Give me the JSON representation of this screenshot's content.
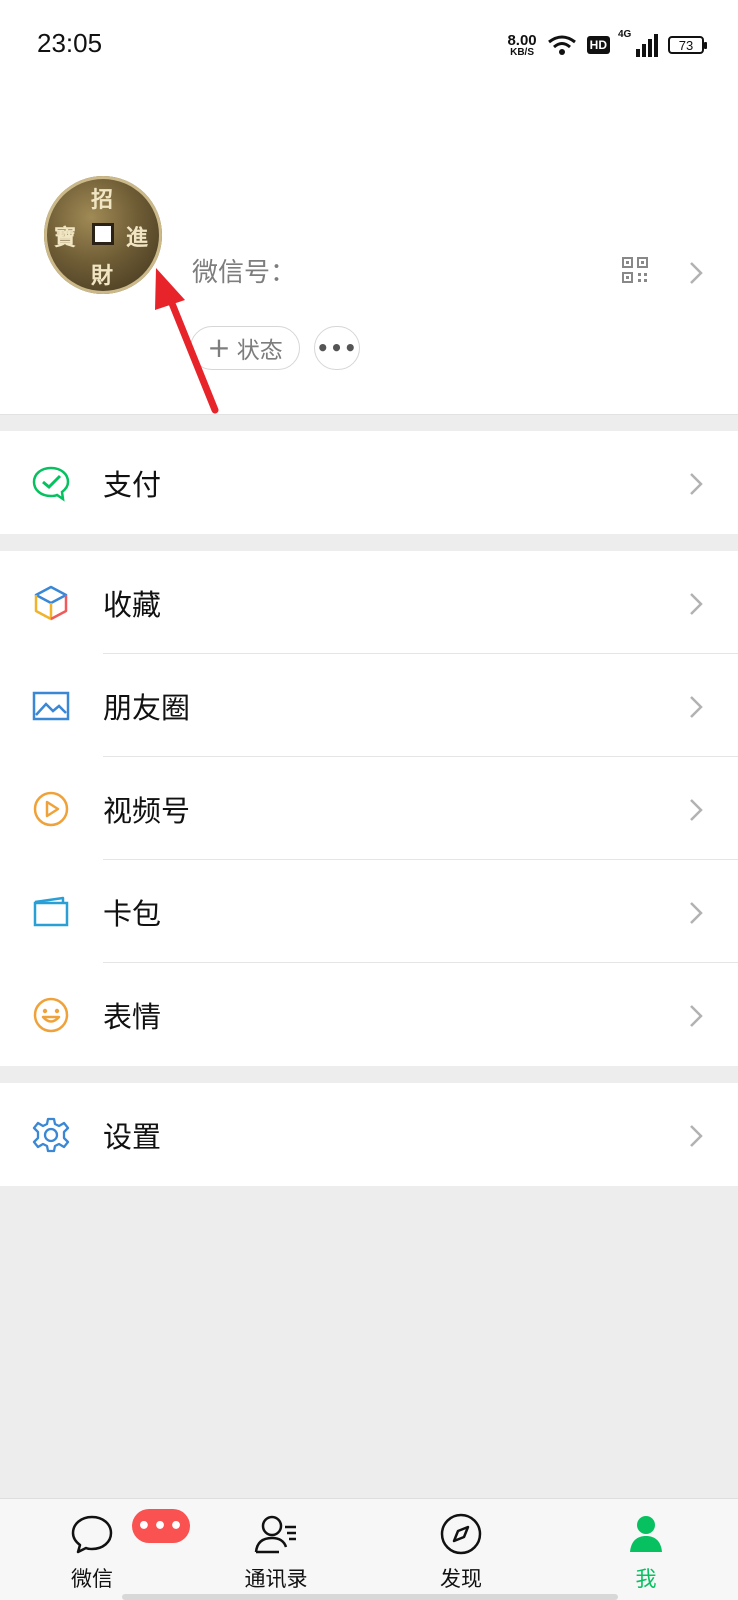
{
  "status_bar": {
    "time": "23:05",
    "net_speed_value": "8.00",
    "net_speed_unit": "KB/S",
    "hd": "HD",
    "network": "4G",
    "battery": "73"
  },
  "profile": {
    "avatar_glyphs": [
      "招",
      "進",
      "財",
      "寶"
    ],
    "wechat_id_label": "微信号：",
    "status_button": "状态",
    "status_plus": "+",
    "more_button": "•••"
  },
  "menu": {
    "pay": "支付",
    "favorites": "收藏",
    "moments": "朋友圈",
    "channels": "视频号",
    "cards": "卡包",
    "stickers": "表情",
    "settings": "设置"
  },
  "tabs": {
    "chats": "微信",
    "contacts": "通讯录",
    "discover": "发现",
    "me": "我",
    "chats_badge": "•••"
  },
  "colors": {
    "accent_green": "#07c160",
    "badge_red": "#fa5151",
    "annotation_arrow": "#e8242b"
  }
}
